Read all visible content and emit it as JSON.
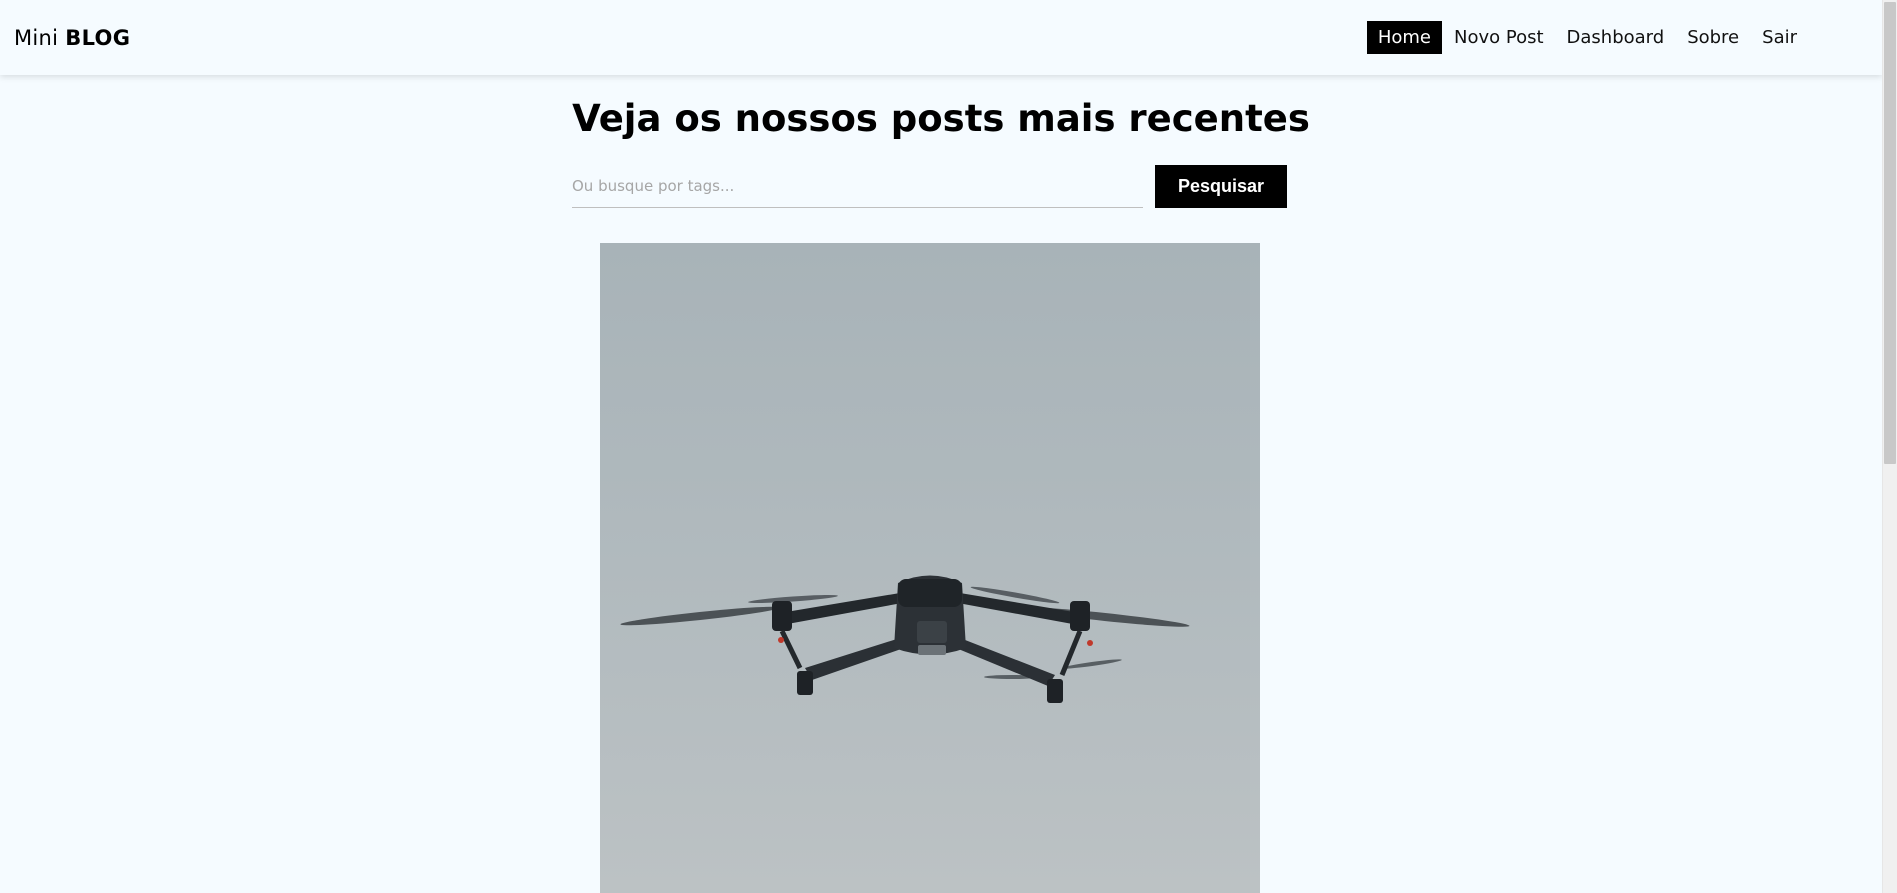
{
  "navbar": {
    "brand_light": "Mini",
    "brand_bold": "BLOG",
    "links": [
      {
        "label": "Home",
        "active": true
      },
      {
        "label": "Novo Post",
        "active": false
      },
      {
        "label": "Dashboard",
        "active": false
      },
      {
        "label": "Sobre",
        "active": false
      },
      {
        "label": "Sair",
        "active": false
      }
    ]
  },
  "home": {
    "title": "Veja os nossos posts mais recentes",
    "search": {
      "placeholder": "Ou busque por tags...",
      "value": "",
      "button_label": "Pesquisar"
    }
  },
  "post": {
    "image_subject": "drone-photo"
  },
  "colors": {
    "background": "#f5fbff",
    "accent": "#000000"
  }
}
